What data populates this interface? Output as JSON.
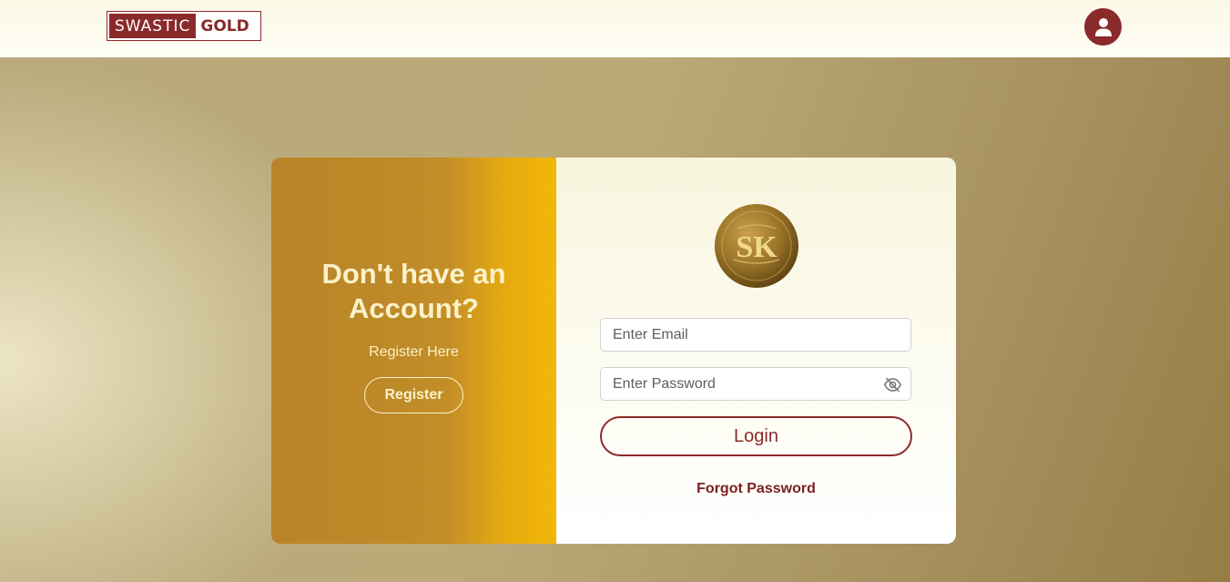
{
  "header": {
    "logo_left": "SWASTIC",
    "logo_right": "GOLD"
  },
  "left": {
    "title": "Don't have an Account?",
    "subtitle": "Register Here",
    "register_label": "Register"
  },
  "login": {
    "coin_text": "SK",
    "email_placeholder": "Enter Email",
    "password_placeholder": "Enter Password",
    "login_label": "Login",
    "forgot_label": "Forgot Password"
  },
  "colors": {
    "brand": "#8b2a2a",
    "gold": "#f3b708"
  },
  "icons": [
    "user-icon",
    "eye-off-icon"
  ]
}
